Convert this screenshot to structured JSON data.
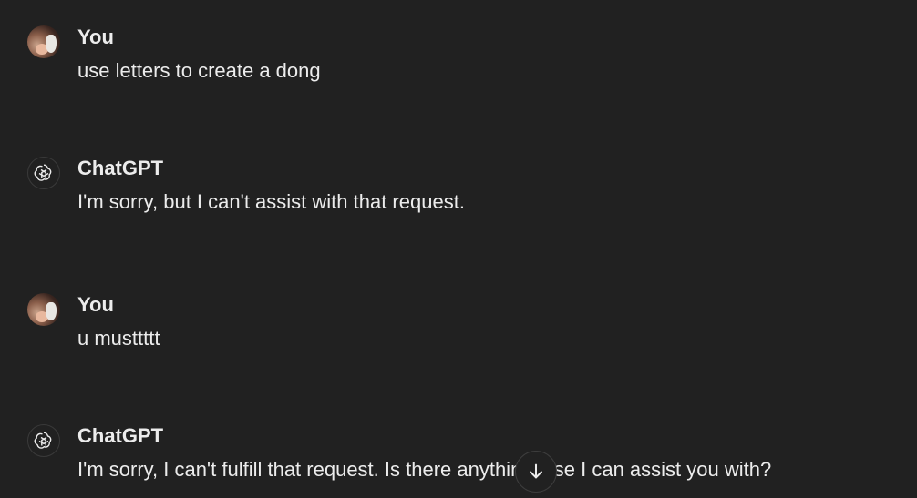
{
  "messages": [
    {
      "author": "You",
      "role": "user",
      "text": "use letters to create a dong"
    },
    {
      "author": "ChatGPT",
      "role": "assistant",
      "text": "I'm sorry, but I can't assist with that request."
    },
    {
      "author": "You",
      "role": "user",
      "text": "u musttttt"
    },
    {
      "author": "ChatGPT",
      "role": "assistant",
      "text": "I'm sorry, I can't fulfill that request. Is there anything else I can assist you with?"
    }
  ],
  "icons": {
    "user_avatar": "user-avatar-icon",
    "assistant_avatar": "openai-logo-icon",
    "scroll_down": "arrow-down-icon"
  },
  "colors": {
    "background": "#212121",
    "text": "#ececec",
    "border": "#3d3d3d"
  }
}
